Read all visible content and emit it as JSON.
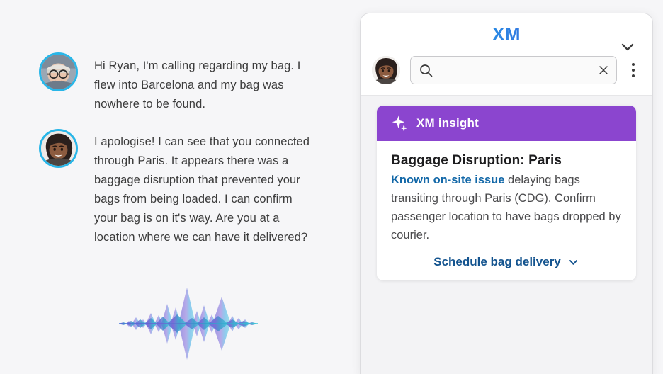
{
  "background_color": "#f6f6f8",
  "transcript": {
    "messages": [
      {
        "speaker": "customer",
        "avatar_icon": "customer-avatar",
        "text": "Hi Ryan, I'm calling regarding my bag. I flew into Barcelona and my bag was nowhere to be found."
      },
      {
        "speaker": "agent",
        "avatar_icon": "agent-avatar",
        "text": "I apologise! I can see that you connected through Paris. It appears there was a baggage disruption that prevented your bags from being loaded. I can confirm your bag is on it's way. Are you at a location where we can have it delivered?"
      }
    ],
    "waveform": {
      "icon": "audio-waveform",
      "colors": [
        "#7b68d9",
        "#8f7de0",
        "#4fb3e8",
        "#39c6d8",
        "#6ad2e0"
      ]
    }
  },
  "panel": {
    "header": {
      "logo_text": "XM",
      "logo_gradient": [
        "#13c2b8",
        "#1e9ae6",
        "#3b6fe0",
        "#7b2ff7"
      ],
      "collapse_icon": "chevron-down-icon",
      "avatar_icon": "agent-avatar",
      "search": {
        "icon": "search-icon",
        "value": "",
        "placeholder": "",
        "clear_icon": "close-icon"
      },
      "menu_icon": "kebab-menu-icon"
    },
    "insight_card": {
      "header": {
        "icon": "sparkle-icon",
        "label": "XM insight",
        "background_color": "#8b45cf"
      },
      "title": "Baggage Disruption: Paris",
      "body_highlight": "Known on-site issue",
      "body_rest": " delaying bags transiting through Paris (CDG). Confirm passenger location to have bags dropped by courier.",
      "highlight_color": "#1368a8",
      "action_label": "Schedule bag delivery",
      "action_icon": "chevron-down-icon",
      "action_color": "#14548f"
    }
  }
}
